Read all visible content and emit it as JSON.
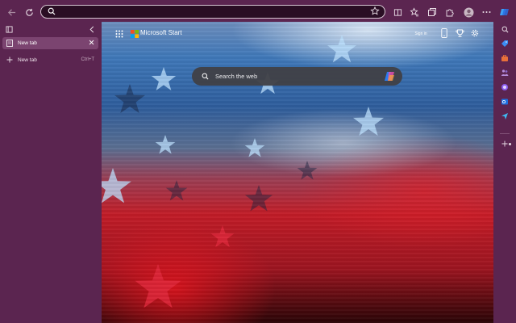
{
  "address_bar": {
    "value": "",
    "placeholder": ""
  },
  "tabs_panel": {
    "tabs": [
      {
        "label": "New tab"
      }
    ],
    "new_tab": {
      "label": "New tab",
      "shortcut": "Ctrl+T"
    }
  },
  "start_page": {
    "brand": "Microsoft Start",
    "sign_in_label": "Sign in",
    "search_placeholder": "Search the web"
  },
  "icons": {
    "back": "back-arrow-icon",
    "refresh": "refresh-icon",
    "search": "search-icon",
    "favorite": "star-outline-icon",
    "split": "split-screen-icon",
    "favorites": "favorites-icon",
    "collections": "collections-icon",
    "extensions": "extensions-icon",
    "profile": "avatar",
    "more": "more-icon",
    "copilot": "copilot-icon",
    "tab_actions": "tab-actions-icon",
    "collapse": "chevron-left-icon",
    "close": "close-icon",
    "add": "plus-icon",
    "apps": "app-launcher-icon",
    "phone": "phone-icon",
    "rewards": "trophy-icon",
    "settings": "gear-icon",
    "rail": [
      "search-icon",
      "tag-icon",
      "briefcase-icon",
      "people-icon",
      "copilot-app-icon",
      "outlook-icon",
      "send-icon",
      "plus-icon"
    ]
  },
  "colors": {
    "frame": "#5b2550",
    "tab_active": "#7b4470",
    "address_bg": "#2a0e24",
    "search_box": "#404046",
    "accent_blue": "#1f6fe0"
  }
}
